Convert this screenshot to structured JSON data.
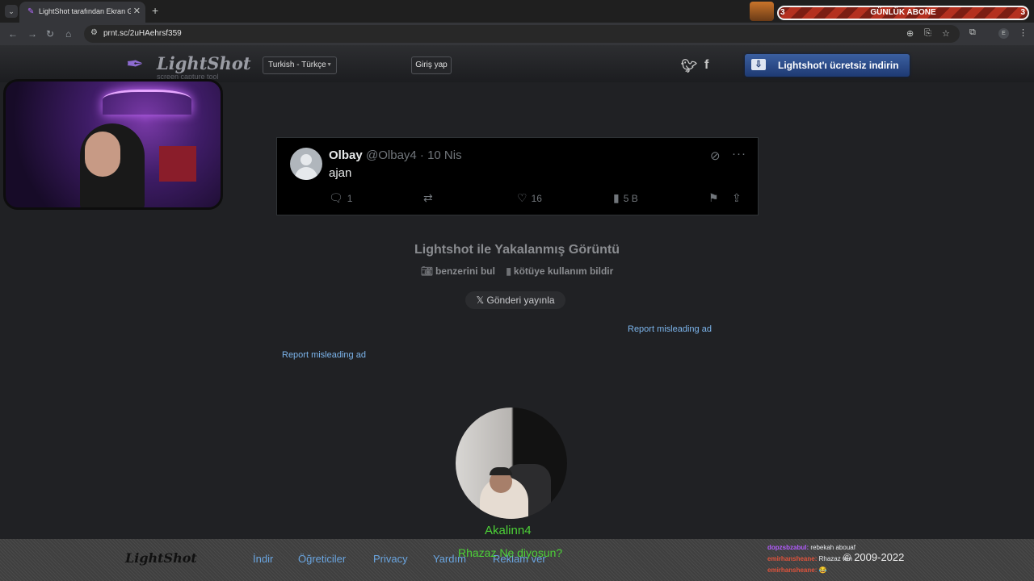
{
  "browser": {
    "tab_title": "LightShot tarafından Ekran Görüntüsü",
    "tab_close": "✕",
    "new_tab": "+",
    "url": "prnt.sc/2uHAehrsf359",
    "profile_initial": "E"
  },
  "stream_goal": {
    "label": "GÜNLÜK ABONE",
    "left_count": "3",
    "right_count": "3"
  },
  "header": {
    "logo_text": "LightShot",
    "logo_subtitle": "screen capture tool",
    "language": "Turkish - Türkçe",
    "login": "Giriş yap",
    "download": "Lightshot'ı ücretsiz indirin"
  },
  "tweet": {
    "name": "Olbay",
    "handle_date": "@Olbay4 · 10 Nis",
    "text": "ajan",
    "replies": "1",
    "likes": "16",
    "views": "5 B"
  },
  "captured": {
    "title": "Lightshot ile Yakalanmış Görüntü",
    "find_similar": "benzerini bul",
    "report_abuse": "kötüye kullanım bildir",
    "post_label": "Gönderi yayınla",
    "report_ad_1": "Report misleading ad",
    "report_ad_2": "Report misleading ad"
  },
  "overlay": {
    "cam_name": "Akalinn4",
    "message": "Rhazaz Ne diyosun?"
  },
  "footer": {
    "logo": "LightShot",
    "links": [
      "İndir",
      "Öğreticiler",
      "Privacy",
      "Yardım",
      "Reklam ver"
    ],
    "copyright": "© 2009-2022"
  },
  "chat": [
    {
      "user": "dopzsbzabul:",
      "text": "rebekah abouaf",
      "color": "#b35cff"
    },
    {
      "user": "emirhansheane:",
      "text": "Rhazaz win",
      "color": "#e0533c"
    },
    {
      "user": "emirhansheane:",
      "text": "😂",
      "color": "#e0533c"
    }
  ]
}
